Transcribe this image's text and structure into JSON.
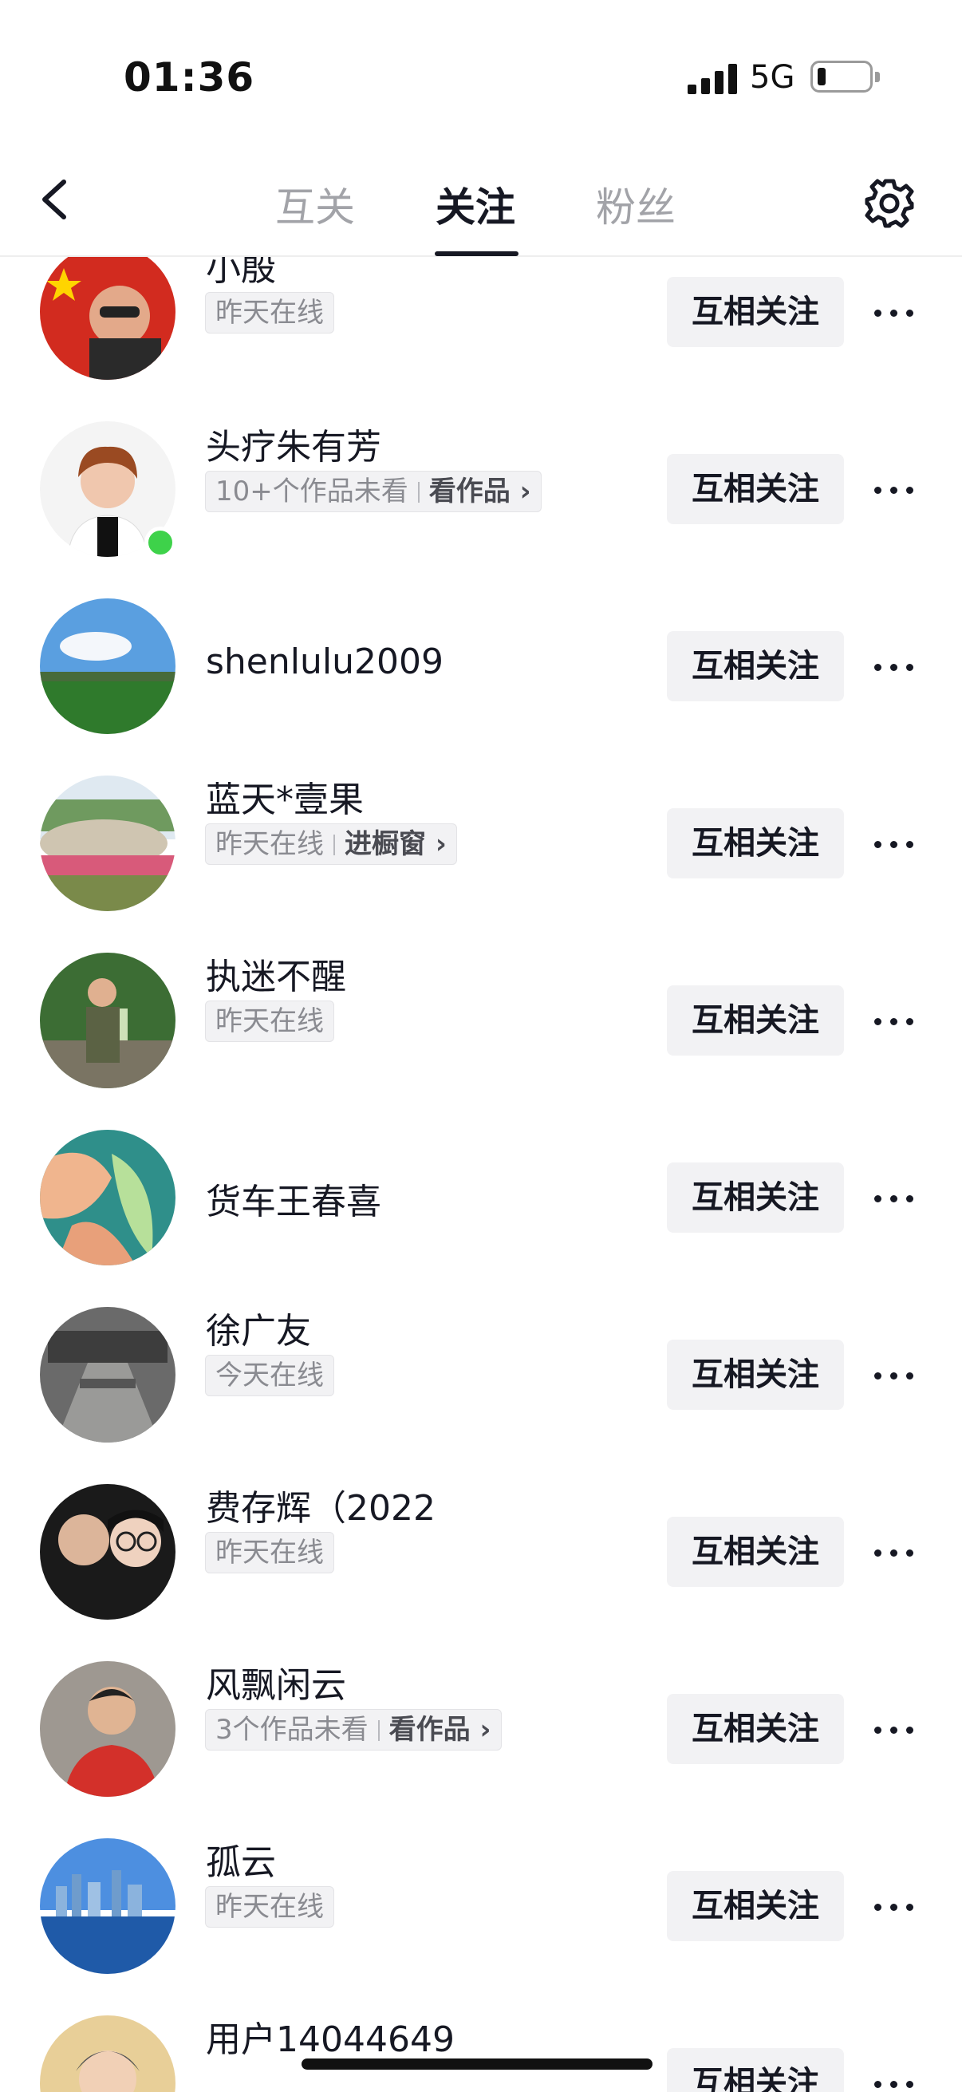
{
  "status_bar": {
    "time": "01:36",
    "network": "5G"
  },
  "header": {
    "tabs": [
      {
        "label": "互关",
        "active": false
      },
      {
        "label": "关注",
        "active": true
      },
      {
        "label": "粉丝",
        "active": false
      }
    ],
    "back_icon": "chevron-left-icon",
    "settings_icon": "gear-icon"
  },
  "follow_button_label": "互相关注",
  "users": [
    {
      "name": "小殷",
      "status": "昨天在线",
      "link": ""
    },
    {
      "name": "头疗朱有芳",
      "status": "10+个作品未看",
      "link": "看作品",
      "online": true
    },
    {
      "name": "shenlulu2009",
      "status": "",
      "link": ""
    },
    {
      "name": "蓝天*壹果",
      "status": "昨天在线",
      "link": "进橱窗"
    },
    {
      "name": "执迷不醒",
      "status": "昨天在线",
      "link": ""
    },
    {
      "name": "货车王春喜",
      "status": "",
      "link": ""
    },
    {
      "name": "徐广友",
      "status": "今天在线",
      "link": ""
    },
    {
      "name": "费存辉（2022",
      "status": "昨天在线",
      "link": ""
    },
    {
      "name": "风飘闲云",
      "status": "3个作品未看",
      "link": "看作品"
    },
    {
      "name": "孤云",
      "status": "昨天在线",
      "link": ""
    },
    {
      "name": "用户14044649",
      "status": "",
      "link": ""
    }
  ],
  "colors": {
    "online": "#3ed24a",
    "button_bg": "#f2f2f4",
    "text": "#161823",
    "muted": "#a2a3a8"
  }
}
